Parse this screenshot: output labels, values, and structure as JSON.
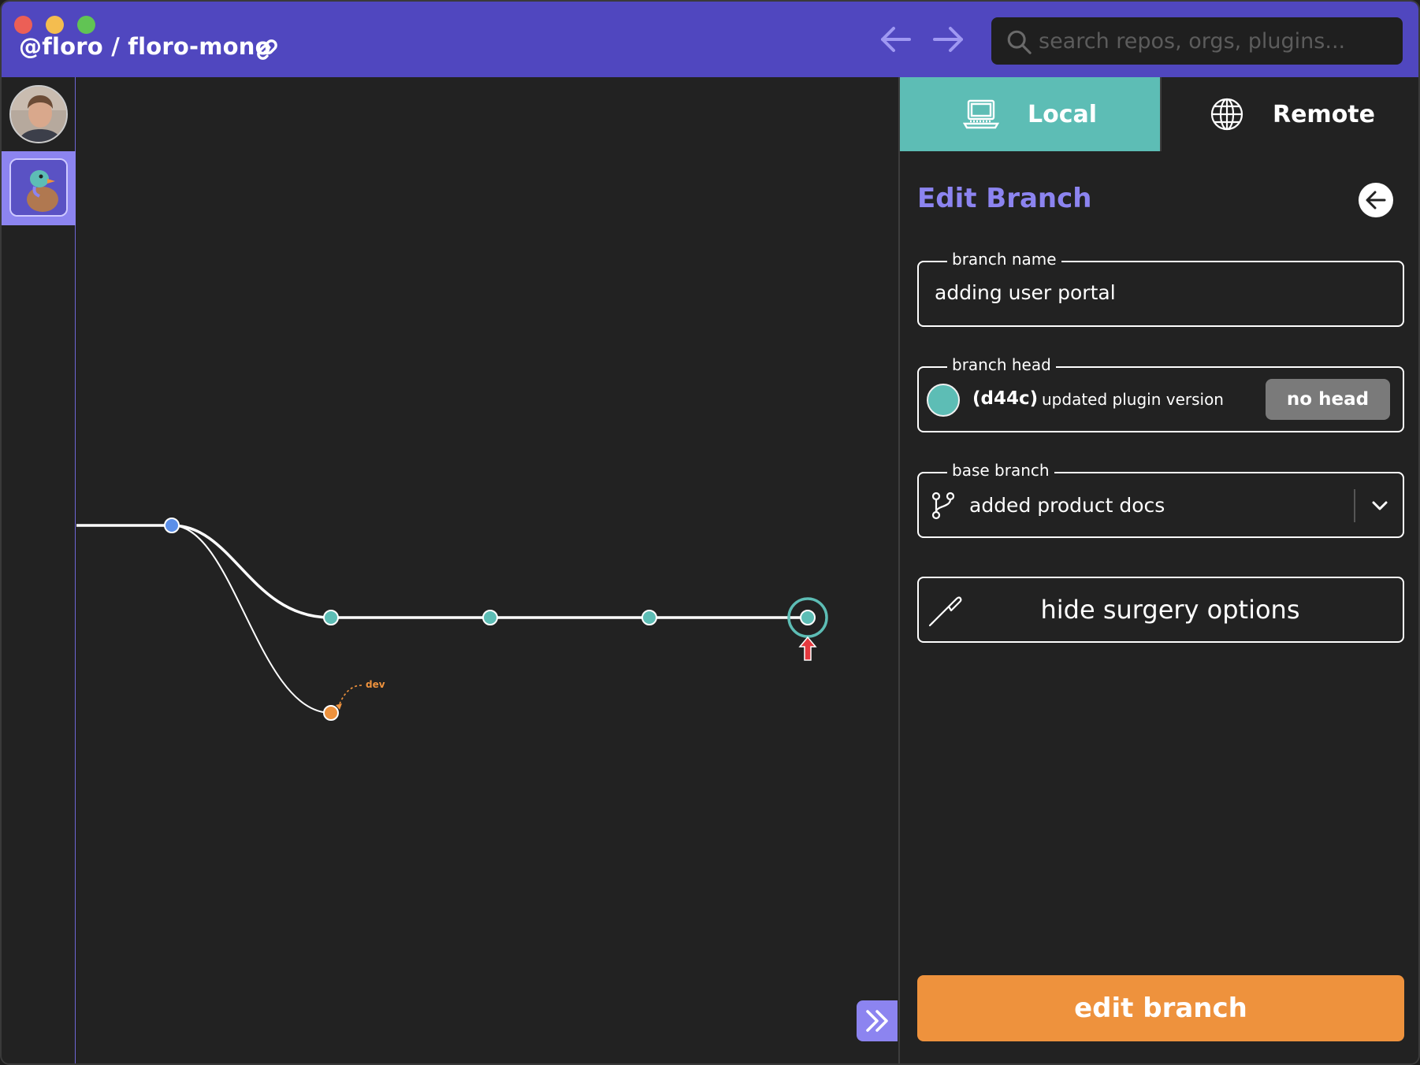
{
  "window": {
    "title": "@floro / floro-mono"
  },
  "search": {
    "placeholder": "search repos, orgs, plugins..."
  },
  "tabs": [
    {
      "label": "Local",
      "icon": "laptop-icon",
      "active": true
    },
    {
      "label": "Remote",
      "icon": "globe-icon",
      "active": false
    }
  ],
  "panel": {
    "title": "Edit Branch",
    "branch_name": {
      "label": "branch name",
      "value": "adding user portal"
    },
    "branch_head": {
      "label": "branch head",
      "sha": "(d44c)",
      "message": "updated plugin version",
      "no_head_label": "no head"
    },
    "base_branch": {
      "label": "base branch",
      "value": "added product docs"
    },
    "surgery_label": "hide surgery options",
    "submit_label": "edit branch"
  },
  "graph": {
    "branch_labels": [
      "dev"
    ]
  },
  "colors": {
    "titlebar": "#5047bf",
    "accent": "#8c84f0",
    "teal": "#5dbdb5",
    "orange": "#ee923d",
    "blue_node": "#5b8fe8",
    "arrow_red": "#e5393f"
  }
}
